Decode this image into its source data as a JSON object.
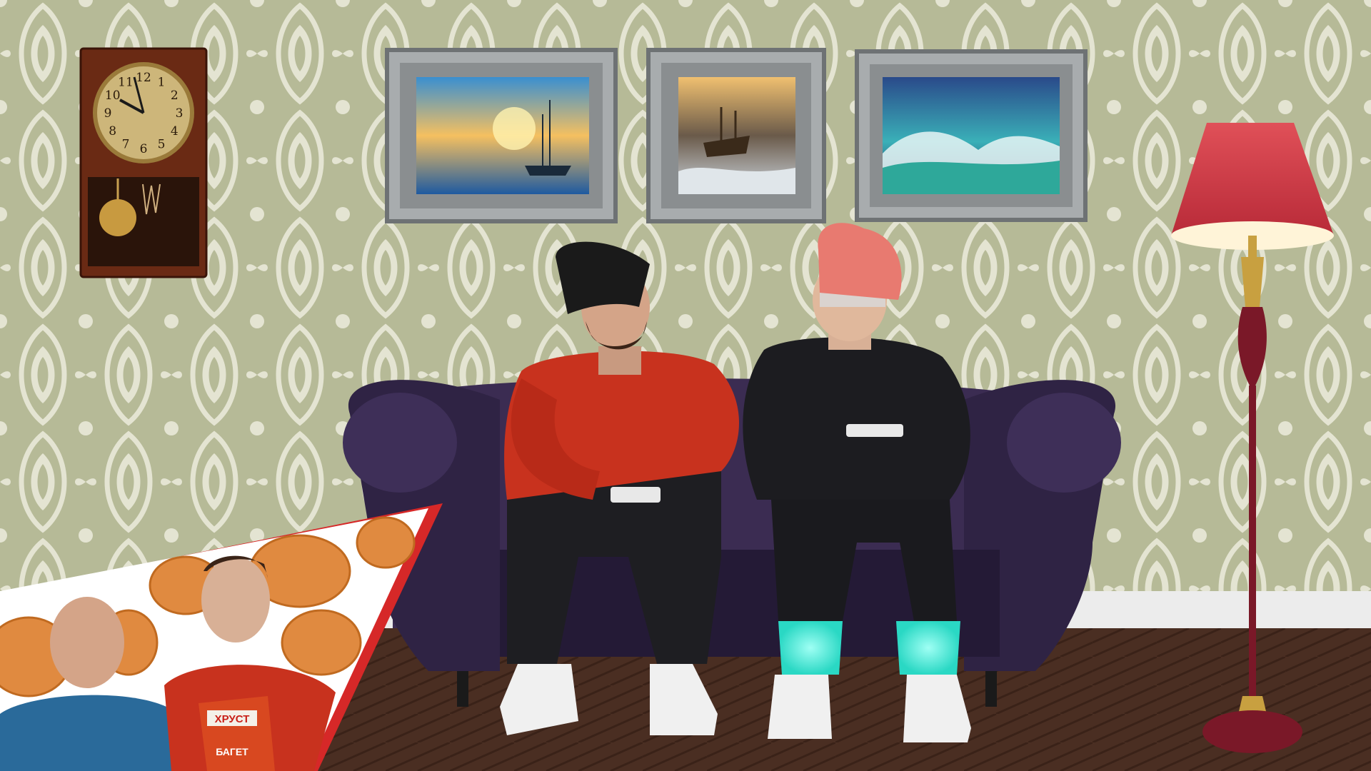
{
  "scene": {
    "description_type": "video-frame",
    "clock": {
      "numerals": [
        "12",
        "1",
        "2",
        "3",
        "4",
        "5",
        "6",
        "7",
        "8",
        "9",
        "10",
        "11"
      ]
    },
    "paintings": [
      {
        "subject": "sailboat-sunset"
      },
      {
        "subject": "ship-in-storm"
      },
      {
        "subject": "ocean-wave"
      }
    ],
    "ad_inset": {
      "product_label_line1": "ХРУСТ",
      "product_label_line2": "БАГЕТ"
    }
  },
  "colors": {
    "wallpaper_base": "#b8bc9a",
    "wallpaper_pattern": "#e6e6d6",
    "sofa": "#3b2c52",
    "floor": "#4a2e22",
    "lamp_shade": "#d8404a",
    "lamp_pole": "#7a1828",
    "red_sweater": "#c8321e",
    "dark_outfit": "#1c1c20",
    "pink_beanie": "#e87a70",
    "black_beanie": "#1a1a1a",
    "accent_red": "#d62828",
    "glow_cyan": "#5ef0e0"
  }
}
